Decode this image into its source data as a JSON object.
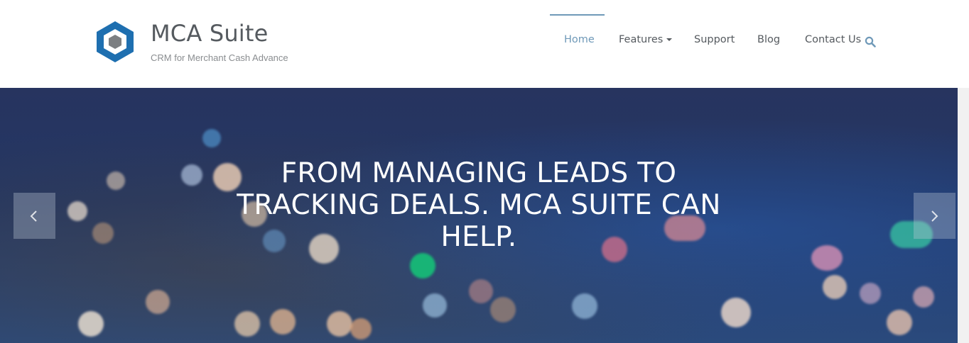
{
  "brand": {
    "title": "MCA Suite",
    "tagline": "CRM for Merchant Cash Advance",
    "logo_icon": "hexagon-logo-icon",
    "logo_color": "#1e6fb0"
  },
  "nav": {
    "items": [
      {
        "label": "Home",
        "active": true
      },
      {
        "label": "Features",
        "dropdown": true
      },
      {
        "label": "Support"
      },
      {
        "label": "Blog"
      },
      {
        "label": "Contact Us"
      }
    ],
    "search_icon": "search-icon",
    "active_color": "#6f99b8",
    "text_color": "#555a5f"
  },
  "hero": {
    "headline": "FROM MANAGING LEADS TO TRACKING DEALS. MCA SUITE CAN HELP.",
    "prev_icon": "chevron-left-icon",
    "next_icon": "chevron-right-icon"
  }
}
